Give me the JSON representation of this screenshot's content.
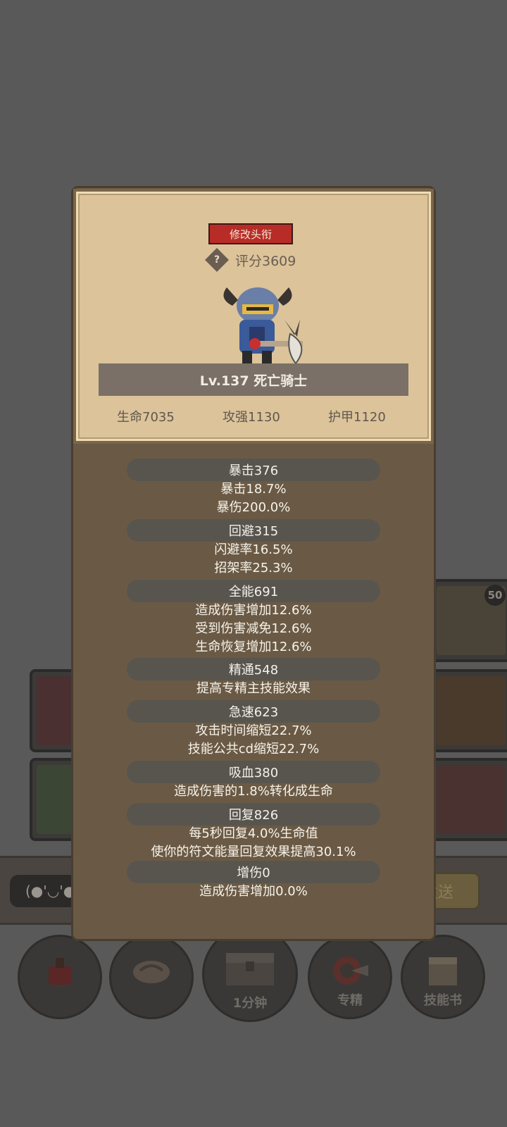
{
  "background": {
    "slots": [
      {
        "name": "skill-slot-top-right",
        "badge": "50"
      },
      {
        "name": "skill-slot-mid-left"
      },
      {
        "name": "skill-slot-mid-right"
      },
      {
        "name": "skill-slot-low-left"
      },
      {
        "name": "skill-slot-low-right"
      }
    ],
    "chat": {
      "emoticon": "(●'◡'●",
      "send_label": "发送"
    },
    "nav": {
      "buttons": [
        {
          "name": "potion-nav-button",
          "label": "",
          "icon": "potion-icon"
        },
        {
          "name": "bread-nav-button",
          "label": "",
          "icon": "bread-icon"
        },
        {
          "name": "chest-nav-button",
          "label": "1分钟",
          "icon": "chest-icon",
          "dot": "!"
        },
        {
          "name": "specialization-nav-button",
          "label": "专精",
          "icon": "target-icon"
        },
        {
          "name": "skillbook-nav-button",
          "label": "技能书",
          "icon": "book-icon"
        }
      ]
    }
  },
  "profile": {
    "title_button": "修改头衔",
    "score": "评分3609",
    "level_name": "Lv.137 死亡骑士",
    "core_stats": [
      "生命7035",
      "攻强1130",
      "护甲1120"
    ]
  },
  "stat_groups": [
    {
      "header": "暴击376",
      "lines": [
        "暴击18.7%",
        "暴伤200.0%"
      ]
    },
    {
      "header": "回避315",
      "lines": [
        "闪避率16.5%",
        "招架率25.3%"
      ]
    },
    {
      "header": "全能691",
      "lines": [
        "造成伤害增加12.6%",
        "受到伤害减免12.6%",
        "生命恢复增加12.6%"
      ]
    },
    {
      "header": "精通548",
      "lines": [
        "提高专精主技能效果"
      ]
    },
    {
      "header": "急速623",
      "lines": [
        "攻击时间缩短22.7%",
        "技能公共cd缩短22.7%"
      ]
    },
    {
      "header": "吸血380",
      "lines": [
        "造成伤害的1.8%转化成生命"
      ]
    },
    {
      "header": "回复826",
      "lines": [
        "每5秒回复4.0%生命值",
        "使你的符文能量回复效果提高30.1%"
      ]
    },
    {
      "header": "增伤0",
      "lines": [
        "造成伤害增加0.0%"
      ]
    }
  ],
  "colors": {
    "accent_red": "#b82c27",
    "parchment": "#dcc39a",
    "panel_brown": "#6a5a45"
  }
}
